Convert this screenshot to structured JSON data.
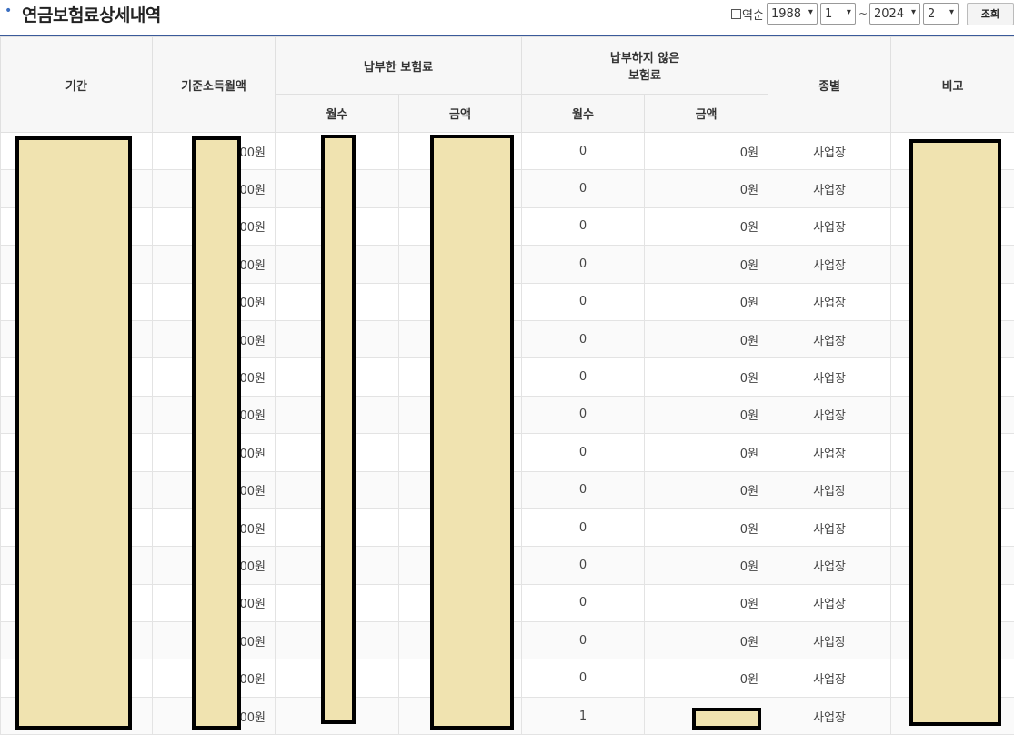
{
  "header": {
    "title": "연금보험료상세내역",
    "reverse_label": "역순",
    "from_year": "1988",
    "from_month": "1",
    "separator": "~",
    "to_year": "2024",
    "to_month": "2",
    "search_button": "조회"
  },
  "columns": {
    "period": "기간",
    "base_income": "기준소득월액",
    "paid_group": "납부한 보험료",
    "unpaid_group": "납부하지 않은\n보험료",
    "type": "종별",
    "note": "비고",
    "paid_months": "월수",
    "paid_amount": "금액",
    "unpaid_months": "월수",
    "unpaid_amount": "금액"
  },
  "rows": [
    {
      "income": "00원",
      "unpaid_months": "0",
      "unpaid_amount": "0원",
      "type": "사업장"
    },
    {
      "income": "00원",
      "unpaid_months": "0",
      "unpaid_amount": "0원",
      "type": "사업장"
    },
    {
      "income": "00원",
      "unpaid_months": "0",
      "unpaid_amount": "0원",
      "type": "사업장"
    },
    {
      "income": "00원",
      "unpaid_months": "0",
      "unpaid_amount": "0원",
      "type": "사업장"
    },
    {
      "income": "00원",
      "unpaid_months": "0",
      "unpaid_amount": "0원",
      "type": "사업장"
    },
    {
      "income": "00원",
      "unpaid_months": "0",
      "unpaid_amount": "0원",
      "type": "사업장"
    },
    {
      "income": "00원",
      "unpaid_months": "0",
      "unpaid_amount": "0원",
      "type": "사업장"
    },
    {
      "income": "00원",
      "unpaid_months": "0",
      "unpaid_amount": "0원",
      "type": "사업장"
    },
    {
      "income": "00원",
      "unpaid_months": "0",
      "unpaid_amount": "0원",
      "type": "사업장"
    },
    {
      "income": "00원",
      "unpaid_months": "0",
      "unpaid_amount": "0원",
      "type": "사업장"
    },
    {
      "income": "00원",
      "unpaid_months": "0",
      "unpaid_amount": "0원",
      "type": "사업장"
    },
    {
      "income": "00원",
      "unpaid_months": "0",
      "unpaid_amount": "0원",
      "type": "사업장"
    },
    {
      "income": "00원",
      "unpaid_months": "0",
      "unpaid_amount": "0원",
      "type": "사업장"
    },
    {
      "income": "00원",
      "unpaid_months": "0",
      "unpaid_amount": "0원",
      "type": "사업장"
    },
    {
      "income": "00원",
      "unpaid_months": "0",
      "unpaid_amount": "0원",
      "type": "사업장"
    },
    {
      "income": "00원",
      "unpaid_months": "1",
      "unpaid_amount": "",
      "type": "사업장"
    }
  ],
  "colors": {
    "accent": "#3a5a9a",
    "redaction_fill": "#f0e3b0",
    "redaction_border": "#000000"
  }
}
